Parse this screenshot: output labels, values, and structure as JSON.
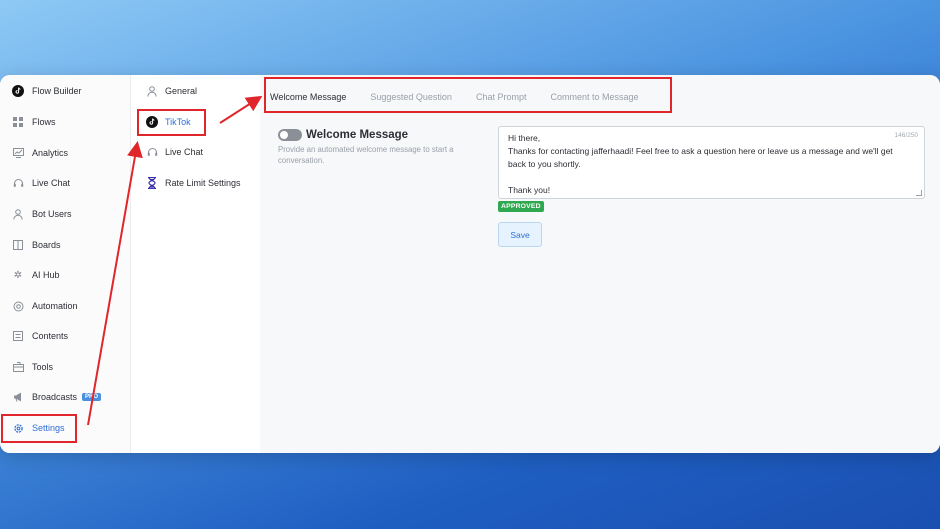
{
  "sidebar": {
    "items": [
      {
        "label": "Flow Builder",
        "icon": "tiktok-icon"
      },
      {
        "label": "Flows",
        "icon": "grid-icon"
      },
      {
        "label": "Analytics",
        "icon": "analytics-icon"
      },
      {
        "label": "Live Chat",
        "icon": "headset-icon"
      },
      {
        "label": "Bot Users",
        "icon": "user-icon"
      },
      {
        "label": "Boards",
        "icon": "board-icon"
      },
      {
        "label": "AI Hub",
        "icon": "ai-icon"
      },
      {
        "label": "Automation",
        "icon": "automation-icon"
      },
      {
        "label": "Contents",
        "icon": "contents-icon"
      },
      {
        "label": "Tools",
        "icon": "tools-icon"
      },
      {
        "label": "Broadcasts",
        "icon": "megaphone-icon",
        "badge": "PRO"
      },
      {
        "label": "Settings",
        "icon": "gear-icon"
      }
    ]
  },
  "subnav": {
    "items": [
      {
        "label": "General",
        "icon": "user-icon"
      },
      {
        "label": "TikTok",
        "icon": "tiktok-icon"
      },
      {
        "label": "Live Chat",
        "icon": "headset-icon"
      },
      {
        "label": "Rate Limit Settings",
        "icon": "hourglass-icon"
      }
    ]
  },
  "tabs": [
    "Welcome Message",
    "Suggested Question",
    "Chat Prompt",
    "Comment to Message"
  ],
  "welcome": {
    "title": "Welcome Message",
    "description": "Provide an automated welcome message to start a conversation.",
    "counter": "146/250",
    "message_lines": [
      "Hi there,",
      "Thanks for contacting jafferhaadi! Feel free to ask a question here or leave us a message and we'll get",
      "back to you shortly.",
      "",
      "Thank you!"
    ],
    "status": "APPROVED",
    "save_label": "Save"
  },
  "colors": {
    "accent": "#2f6fd6",
    "highlight": "#e0262a",
    "approved": "#2fa84f"
  }
}
